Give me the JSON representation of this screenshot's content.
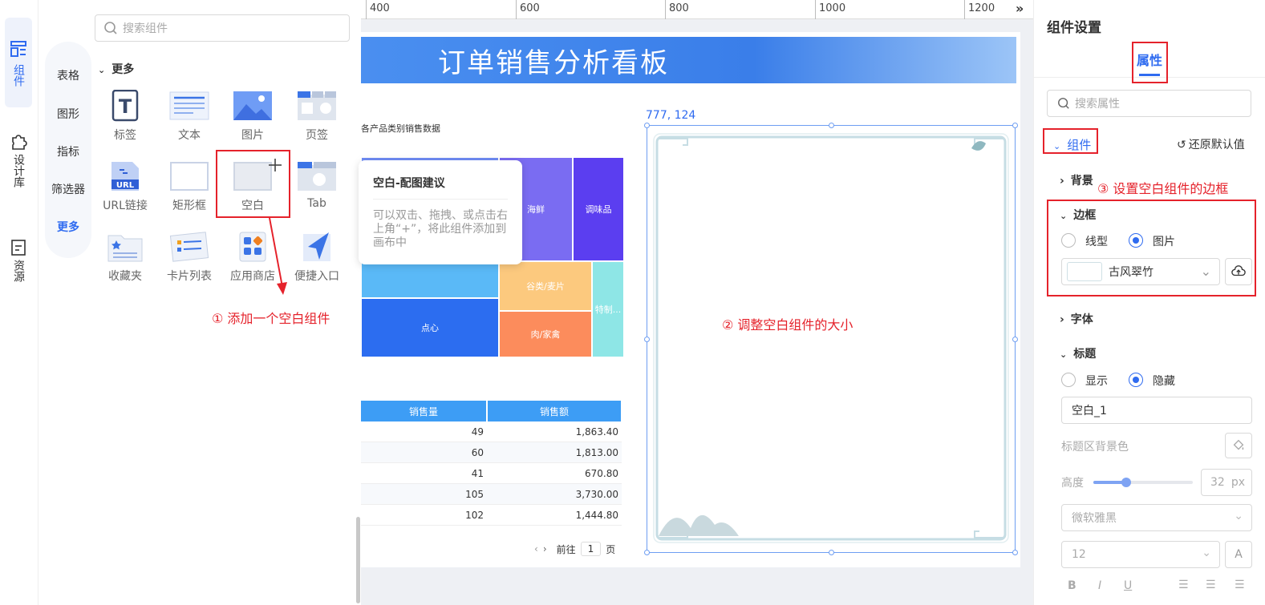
{
  "rail": {
    "items": [
      {
        "label": "组件",
        "icon": "component-icon"
      },
      {
        "label": "设计库",
        "icon": "puzzle-icon"
      },
      {
        "label": "资源",
        "icon": "resource-icon"
      }
    ]
  },
  "panel": {
    "search_placeholder": "搜索组件",
    "categories": [
      "表格",
      "图形",
      "指标",
      "筛选器",
      "更多"
    ],
    "section_title": "更多",
    "tiles": [
      {
        "label": "标签",
        "icon": "label-T-icon"
      },
      {
        "label": "文本",
        "icon": "text-lines-icon"
      },
      {
        "label": "图片",
        "icon": "image-icon"
      },
      {
        "label": "页签",
        "icon": "tabs-icon"
      },
      {
        "label": "URL链接",
        "icon": "url-link-icon",
        "badge": "URL"
      },
      {
        "label": "矩形框",
        "icon": "rectangle-icon"
      },
      {
        "label": "空白",
        "icon": "blank-icon"
      },
      {
        "label": "Tab",
        "icon": "tab-icon"
      },
      {
        "label": "收藏夹",
        "icon": "favorites-folder-icon"
      },
      {
        "label": "卡片列表",
        "icon": "card-list-icon"
      },
      {
        "label": "应用商店",
        "icon": "app-store-icon"
      },
      {
        "label": "便捷入口",
        "icon": "quick-entry-icon"
      }
    ]
  },
  "tooltip": {
    "title": "空白-配图建议",
    "body": "可以双击、拖拽、或点击右上角“+”，将此组件添加到画布中"
  },
  "ruler": {
    "marks": [
      "400",
      "600",
      "800",
      "1000",
      "1200"
    ]
  },
  "dashboard": {
    "title": "订单销售分析看板",
    "chart_title": "各产品类别销售数据",
    "treemap": [
      {
        "label": "海鲜",
        "color": "#7a6cf2"
      },
      {
        "label": "调味品",
        "color": "#5b3ef0"
      },
      {
        "label": "谷类/麦片",
        "color": "#fcc97e"
      },
      {
        "label": "特制...",
        "color": "#8ee6e6"
      },
      {
        "label": "点心",
        "color": "#2c6df0"
      },
      {
        "label": "肉/家禽",
        "color": "#fc8c5c"
      }
    ],
    "table": {
      "headers": [
        "销售量",
        "销售额"
      ],
      "rows": [
        [
          "49",
          "1,863.40"
        ],
        [
          "60",
          "1,813.00"
        ],
        [
          "41",
          "670.80"
        ],
        [
          "105",
          "3,730.00"
        ],
        [
          "102",
          "1,444.80"
        ]
      ]
    },
    "pagination": {
      "prefix": "前往",
      "page": "1",
      "suffix": "页"
    }
  },
  "selection": {
    "coords": "777, 124"
  },
  "props": {
    "title": "组件设置",
    "tab": "属性",
    "search_placeholder": "搜索属性",
    "group": "组件",
    "reset": "还原默认值",
    "background": "背景",
    "border": "边框",
    "border_line": "线型",
    "border_image": "图片",
    "border_value": "古风翠竹",
    "font": "字体",
    "title_section": "标题",
    "show": "显示",
    "hide": "隐藏",
    "title_value": "空白_1",
    "title_bg": "标题区背景色",
    "height_label": "高度",
    "height_value": "32",
    "height_unit": "px",
    "height_fraction": 0.33,
    "font_family": "微软雅黑",
    "font_size": "12",
    "font_btn": "A",
    "bold": "B",
    "italic": "I",
    "underline": "U"
  },
  "annotations": {
    "step1": "① 添加一个空白组件",
    "step2": "② 调整空白组件的大小",
    "step3": "③ 设置空白组件的边框"
  },
  "colors": {
    "accent": "#2f6bf0",
    "annotation": "#e5222b",
    "header_blue": "#3d9df5"
  }
}
